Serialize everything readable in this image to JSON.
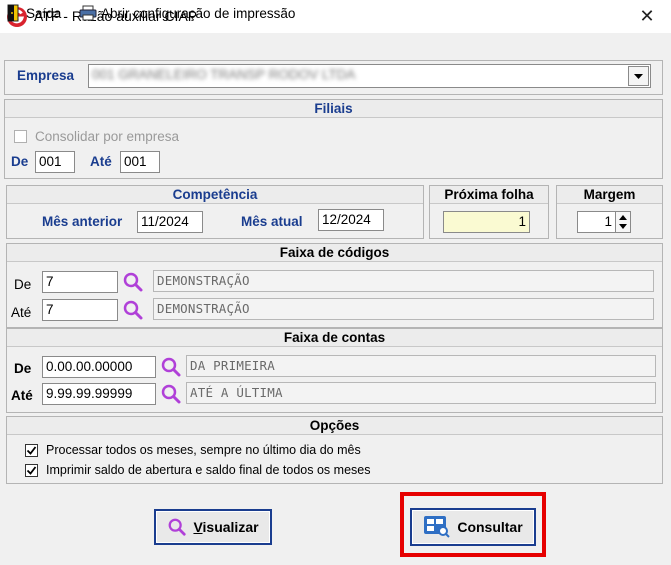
{
  "window": {
    "title": "ATF - Razão auxiliar CIAP",
    "close_glyph": "✕"
  },
  "menu": {
    "exit_label": "Saída",
    "print_config_label": "Abrir configuração de impressão"
  },
  "empresa": {
    "label": "Empresa",
    "value": "001 GRANELEIRO TRANSP RODOV LTDA"
  },
  "filiais": {
    "heading": "Filiais",
    "consolidate_label": "Consolidar por empresa",
    "consolidate_checked": false,
    "from_label": "De",
    "from_value": "001",
    "to_label": "Até",
    "to_value": "001"
  },
  "competencia": {
    "heading": "Competência",
    "prev_month_label": "Mês anterior",
    "prev_month_value": "11/2024",
    "current_month_label": "Mês atual",
    "current_month_value": "12/2024"
  },
  "proxima_folha": {
    "heading": "Próxima folha",
    "value": "1"
  },
  "margem": {
    "heading": "Margem",
    "value": "1"
  },
  "faixa_codigos": {
    "heading": "Faixa de códigos",
    "from_label": "De",
    "from_value": "7",
    "from_desc": "DEMONSTRAÇÃO",
    "to_label": "Até",
    "to_value": "7",
    "to_desc": "DEMONSTRAÇÃO"
  },
  "faixa_contas": {
    "heading": "Faixa de contas",
    "from_label": "De",
    "from_value": "0.00.00.00000",
    "from_desc": "DA PRIMEIRA",
    "to_label": "Até",
    "to_value": "9.99.99.99999",
    "to_desc": "ATÉ A ÚLTIMA"
  },
  "opcoes": {
    "heading": "Opções",
    "opt1_label": "Processar todos os meses, sempre no último dia do mês",
    "opt1_checked": true,
    "opt2_label": "Imprimir saldo de abertura e saldo final de todos os meses",
    "opt2_checked": true
  },
  "buttons": {
    "view_accel": "V",
    "view_rest": "isualizar",
    "query_label": "Consultar"
  },
  "colors": {
    "accent": "#1a3d8f",
    "highlight": "#e60000",
    "yellow_field": "#fafad2",
    "lens": "#b040d8"
  },
  "icons": [
    "app-logo-icon",
    "exit-door-icon",
    "printer-icon",
    "dropdown-arrow-icon",
    "search-lens-icon",
    "consult-icon",
    "check-icon"
  ]
}
